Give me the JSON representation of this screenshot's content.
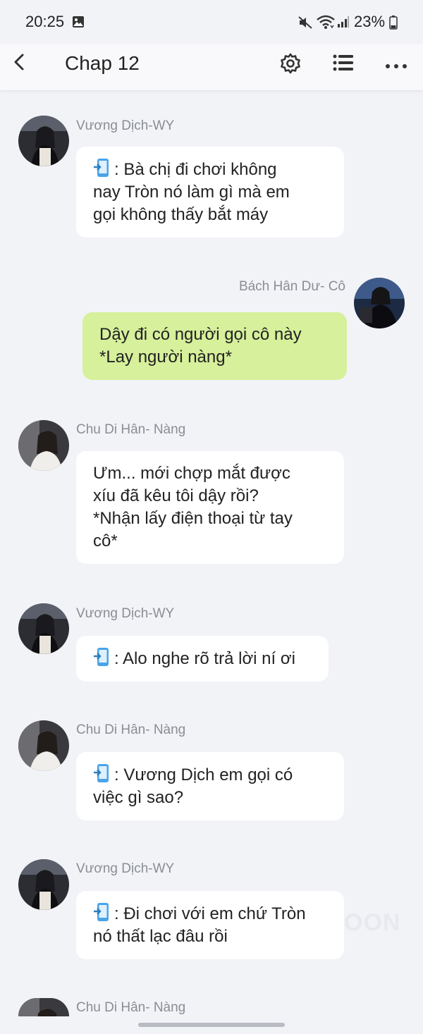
{
  "status_bar": {
    "time": "20:25",
    "battery": "23%"
  },
  "header": {
    "title": "Chap 12"
  },
  "messages": [
    {
      "sender": "Vương Dịch-WY",
      "side": "left",
      "lines": [
        ":  Bà chị đi chơi không",
        "nay Tròn nó làm gì mà em",
        "gọi không thấy bắt máy"
      ],
      "phone_icon": true
    },
    {
      "sender": "Bách Hân Dư- Cô",
      "side": "right",
      "lines": [
        "Dậy đi có người gọi cô này",
        "*Lay người nàng*"
      ],
      "phone_icon": false
    },
    {
      "sender": "Chu Di Hân- Nàng",
      "side": "left",
      "lines": [
        "Ưm... mới chợp mắt được",
        "xíu đã kêu tôi dậy rồi?",
        "*Nhận lấy điện thoại từ tay",
        "cô*"
      ],
      "phone_icon": false
    },
    {
      "sender": "Vương Dịch-WY",
      "side": "left",
      "lines": [
        ": Alo nghe rõ trả lời ní ơi"
      ],
      "phone_icon": true
    },
    {
      "sender": "Chu Di Hân- Nàng",
      "side": "left",
      "lines": [
        ": Vương Dịch em gọi có",
        "việc gì sao?"
      ],
      "phone_icon": true
    },
    {
      "sender": "Vương Dịch-WY",
      "side": "left",
      "lines": [
        ": Đi chơi với em chứ Tròn",
        "nó thất lạc đâu rồi"
      ],
      "phone_icon": true
    },
    {
      "sender": "Chu Di Hân- Nàng",
      "side": "left",
      "lines": [],
      "phone_icon": false
    }
  ],
  "watermark": "OON",
  "colors": {
    "background": "#f2f3f7",
    "bubble_other": "#ffffff",
    "bubble_mine": "#d6f09b",
    "sender_name": "#8a8d94",
    "phone_icon_blue": "#4aa3e8"
  },
  "icons": {
    "back": "chevron-left-icon",
    "settings": "gear-icon",
    "chapter_list": "list-icon",
    "more": "more-horizontal-icon",
    "phone_receiving": "phone-incoming-icon"
  }
}
